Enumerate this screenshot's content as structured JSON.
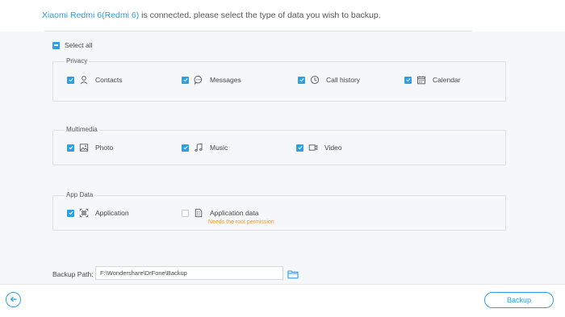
{
  "header": {
    "device_name": "Xiaomi Redmi 6(Redmi 6)",
    "message": " is connected. please select the type of data you wish to backup."
  },
  "select_all": {
    "label": "Select all",
    "state": "partial"
  },
  "groups": [
    {
      "title": "Privacy",
      "items": [
        {
          "label": "Contacts",
          "icon": "person-icon",
          "checked": true
        },
        {
          "label": "Messages",
          "icon": "message-bubble-icon",
          "checked": true
        },
        {
          "label": "Call history",
          "icon": "clock-icon",
          "checked": true
        },
        {
          "label": "Calendar",
          "icon": "calendar-icon",
          "checked": true
        }
      ]
    },
    {
      "title": "Multimedia",
      "items": [
        {
          "label": "Photo",
          "icon": "image-icon",
          "checked": true
        },
        {
          "label": "Music",
          "icon": "music-note-icon",
          "checked": true
        },
        {
          "label": "Video",
          "icon": "video-camera-icon",
          "checked": true
        }
      ]
    },
    {
      "title": "App Data",
      "items": [
        {
          "label": "Application",
          "icon": "application-scan-icon",
          "checked": true
        },
        {
          "label": "Application data",
          "icon": "app-data-file-icon",
          "checked": false,
          "note": "Needs the root permission"
        }
      ]
    }
  ],
  "backup_path": {
    "label": "Backup Path:",
    "value": "F:\\Wondershare\\DrFone\\Backup"
  },
  "footer": {
    "backup_label": "Backup"
  },
  "colors": {
    "accent": "#2f9ee5",
    "warning": "#f19a1c",
    "panel_bg": "#f6f7f9"
  }
}
